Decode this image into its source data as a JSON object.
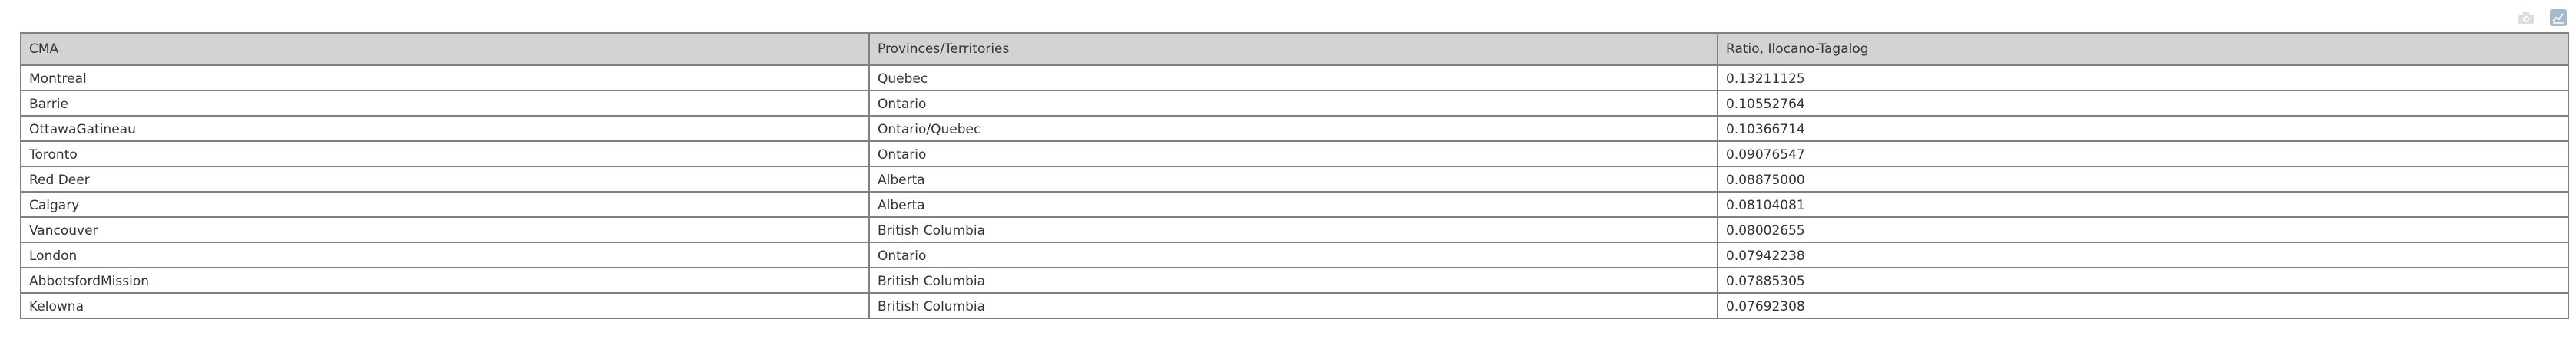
{
  "toolbar": {
    "camera_icon": "camera-icon",
    "chart_icon": "chart-icon"
  },
  "table": {
    "columns": [
      "CMA",
      "Provinces/Territories",
      "Ratio, Ilocano-Tagalog"
    ],
    "rows": [
      [
        "Montreal",
        "Quebec",
        "0.13211125"
      ],
      [
        "Barrie",
        "Ontario",
        "0.10552764"
      ],
      [
        "OttawaGatineau",
        "Ontario/Quebec",
        "0.10366714"
      ],
      [
        "Toronto",
        "Ontario",
        "0.09076547"
      ],
      [
        "Red Deer",
        "Alberta",
        "0.08875000"
      ],
      [
        "Calgary",
        "Alberta",
        "0.08104081"
      ],
      [
        "Vancouver",
        "British Columbia",
        "0.08002655"
      ],
      [
        "London",
        "Ontario",
        "0.07942238"
      ],
      [
        "AbbotsfordMission",
        "British Columbia",
        "0.07885305"
      ],
      [
        "Kelowna",
        "British Columbia",
        "0.07692308"
      ]
    ]
  },
  "colors": {
    "header_bg": "#d3d3d3",
    "border": "#808080",
    "text": "#333333",
    "icon_camera": "#dcdcdc",
    "icon_chart": "#a8b8cc"
  }
}
